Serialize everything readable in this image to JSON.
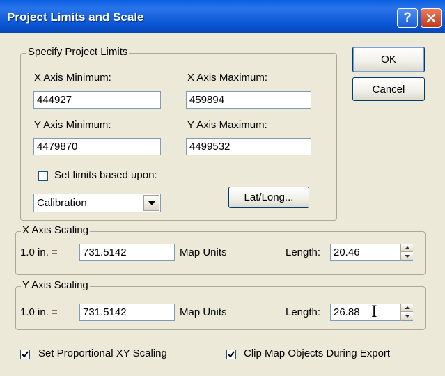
{
  "window": {
    "title": "Project Limits and Scale",
    "help_label": "?"
  },
  "project_limits": {
    "legend": "Specify Project Limits",
    "x_min_label": "X Axis Minimum:",
    "x_min_value": "444927",
    "x_max_label": "X Axis Maximum:",
    "x_max_value": "459894",
    "y_min_label": "Y Axis Minimum:",
    "y_min_value": "4479870",
    "y_max_label": "Y Axis Maximum:",
    "y_max_value": "4499532",
    "set_limits_label": "Set limits based upon:",
    "set_limits_checked": false,
    "basis_selected": "Calibration",
    "latlong_label": "Lat/Long..."
  },
  "buttons": {
    "ok": "OK",
    "cancel": "Cancel"
  },
  "x_scaling": {
    "legend": "X Axis Scaling",
    "prefix": "1.0 in. =",
    "value": "731.5142",
    "units": "Map Units",
    "length_label": "Length:",
    "length_value": "20.46"
  },
  "y_scaling": {
    "legend": "Y Axis Scaling",
    "prefix": "1.0 in. =",
    "value": "731.5142",
    "units": "Map Units",
    "length_label": "Length:",
    "length_value": "26.88"
  },
  "options": {
    "proportional_label": "Set Proportional XY Scaling",
    "proportional_checked": true,
    "clip_label": "Clip Map Objects During Export",
    "clip_checked": true
  }
}
